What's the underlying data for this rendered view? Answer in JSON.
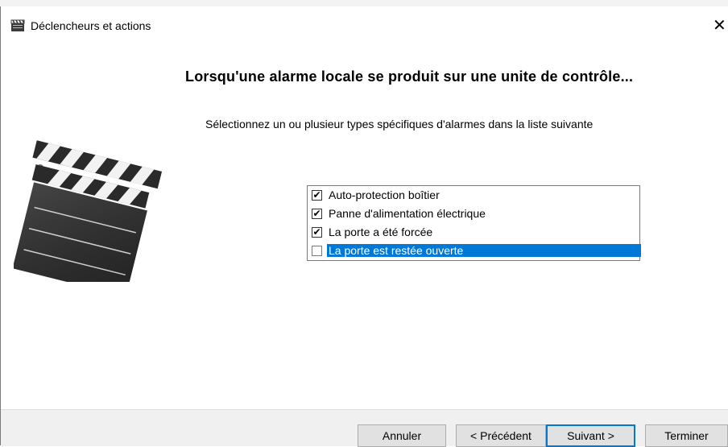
{
  "window": {
    "title": "Déclencheurs et actions",
    "close_glyph": "✕",
    "icon": "clapperboard-icon"
  },
  "main": {
    "heading": "Lorsqu'une alarme locale se produit sur une unite de contrôle...",
    "instruction": "Sélectionnez un ou plusieur types spécifiques d'alarmes dans la liste suivante",
    "illustration": "clapperboard-illustration",
    "alarm_types": [
      {
        "label": "Auto-protection boîtier",
        "checked": true,
        "check_glyph": "✔"
      },
      {
        "label": "Panne d'alimentation électrique",
        "checked": true,
        "check_glyph": "✔"
      },
      {
        "label": "La porte a été forcée",
        "checked": true,
        "check_glyph": "✔"
      },
      {
        "label": "La porte est restée ouverte",
        "checked": false,
        "selected": true,
        "check_glyph": ""
      }
    ]
  },
  "footer": {
    "cancel_label": "Annuler",
    "previous_label": "< Précédent",
    "next_label": "Suivant >",
    "finish_label": "Terminer"
  },
  "colors": {
    "selection": "#0078d7",
    "button_face": "#e1e1e1",
    "footer_bg": "#f0f0f0"
  }
}
